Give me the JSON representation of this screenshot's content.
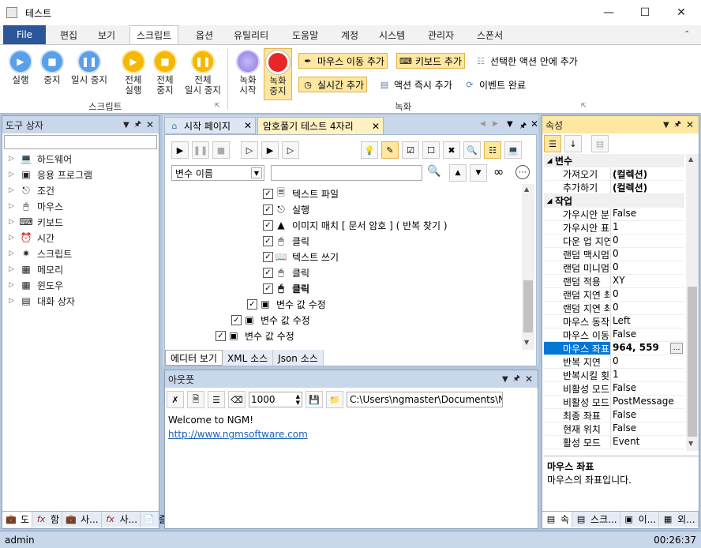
{
  "window": {
    "title": "테스트"
  },
  "menu": {
    "file": "File",
    "tabs": [
      "편집",
      "보기",
      "스크립트",
      "옵션",
      "유틸리티",
      "도움말",
      "계정",
      "시스템",
      "관리자",
      "스폰서"
    ]
  },
  "ribbon": {
    "script_group": {
      "label": "스크립트",
      "buttons": [
        "실행",
        "중지",
        "일시 중지"
      ],
      "all_buttons": [
        [
          "전체",
          "실행"
        ],
        [
          "전체",
          "중지"
        ],
        [
          "전체",
          "일시 중지"
        ]
      ]
    },
    "record_group": {
      "label": "녹화",
      "start": [
        "녹화",
        "시작"
      ],
      "stop": [
        "녹화",
        "중지"
      ],
      "add_mouse_move": "마우스 이동 추가",
      "add_keyboard": "키보드 추가",
      "add_inside_selected": "선택한 액션 안에 추가",
      "add_realtime": "실시간 추가",
      "add_action_now": "액션 즉시 추가",
      "event_done": "이벤트 완료"
    }
  },
  "toolbox": {
    "title": "도구 상자",
    "items": [
      "하드웨어",
      "응용 프로그램",
      "조건",
      "마우스",
      "키보드",
      "시간",
      "스크립트",
      "메모리",
      "윈도우",
      "대화 상자"
    ],
    "bottom_tabs": [
      "도",
      "함",
      "사...",
      "사...",
      "즐"
    ]
  },
  "editor": {
    "tabs": [
      "시작 페이지",
      "암호풀기 테스트 4자리"
    ],
    "variable_select": "변수 이름",
    "actions": [
      {
        "text": "텍스트 파일",
        "icon": "text-file-icon",
        "bold": false,
        "indent": 0
      },
      {
        "text": "실행",
        "icon": "run-icon",
        "bold": false,
        "indent": 0
      },
      {
        "text": "이미지 매치 [ 문서 암호 ] ( 반복 찾기 )",
        "icon": "image-match-icon",
        "bold": false,
        "indent": 0
      },
      {
        "text": "클릭",
        "icon": "mouse-click-icon",
        "bold": false,
        "indent": 0
      },
      {
        "text": "텍스트 쓰기",
        "icon": "write-text-icon",
        "bold": false,
        "indent": 0
      },
      {
        "text": "클릭",
        "icon": "mouse-click-icon",
        "bold": false,
        "indent": 0
      },
      {
        "text": "클릭",
        "icon": "mouse-click-icon",
        "bold": true,
        "indent": 0
      },
      {
        "text": "변수 값 수정",
        "icon": "variable-box-icon",
        "bold": false,
        "indent": 1
      },
      {
        "text": "변수 값 수정",
        "icon": "variable-box-icon",
        "bold": false,
        "indent": 2
      },
      {
        "text": "변수 값 수정",
        "icon": "variable-box-icon",
        "bold": false,
        "indent": 3
      }
    ],
    "bottom_tabs": [
      "에디터 보기",
      "XML 소스",
      "Json 소스"
    ]
  },
  "output": {
    "title": "아웃풋",
    "interval": "1000",
    "path": "C:\\Users\\ngmaster\\Documents\\NGM",
    "welcome": "Welcome to NGM!",
    "link": "http://www.ngmsoftware.com"
  },
  "properties": {
    "title": "속성",
    "categories": [
      {
        "name": "변수",
        "rows": [
          [
            "가져오기",
            "(컬렉션)"
          ],
          [
            "추가하기",
            "(컬렉션)"
          ]
        ]
      },
      {
        "name": "작업",
        "rows": [
          [
            "가우시안 분",
            "False"
          ],
          [
            "가우시안 표",
            "1"
          ],
          [
            "다운 업 지연",
            "0"
          ],
          [
            "랜덤 맥시멈",
            "0"
          ],
          [
            "랜덤 미니멈",
            "0"
          ],
          [
            "랜덤 적용",
            "XY"
          ],
          [
            "랜덤 지연 최",
            "0"
          ],
          [
            "랜덤 지연 최",
            "0"
          ],
          [
            "마우스 동작",
            "Left"
          ],
          [
            "마우스 이동",
            "False"
          ],
          [
            "마우스 좌표",
            "964, 559"
          ],
          [
            "반복 지연",
            "0"
          ],
          [
            "반복시킬 횟",
            "1"
          ],
          [
            "비활성 모드",
            "False"
          ],
          [
            "비활성 모드",
            "PostMessage"
          ],
          [
            "최종 좌표",
            "False"
          ],
          [
            "현재 위치",
            "False"
          ],
          [
            "활성 모드",
            "Event"
          ]
        ]
      }
    ],
    "desc_title": "마우스 좌표",
    "desc_text": "마우스의 좌표입니다.",
    "bottom_tabs": [
      "속",
      "스크...",
      "이...",
      "외..."
    ]
  },
  "status": {
    "user": "admin",
    "time": "00:26:37"
  },
  "colors": {
    "accent": "#2b579a",
    "panel_header": "#c9d7ea",
    "highlight": "#fde7a1"
  }
}
